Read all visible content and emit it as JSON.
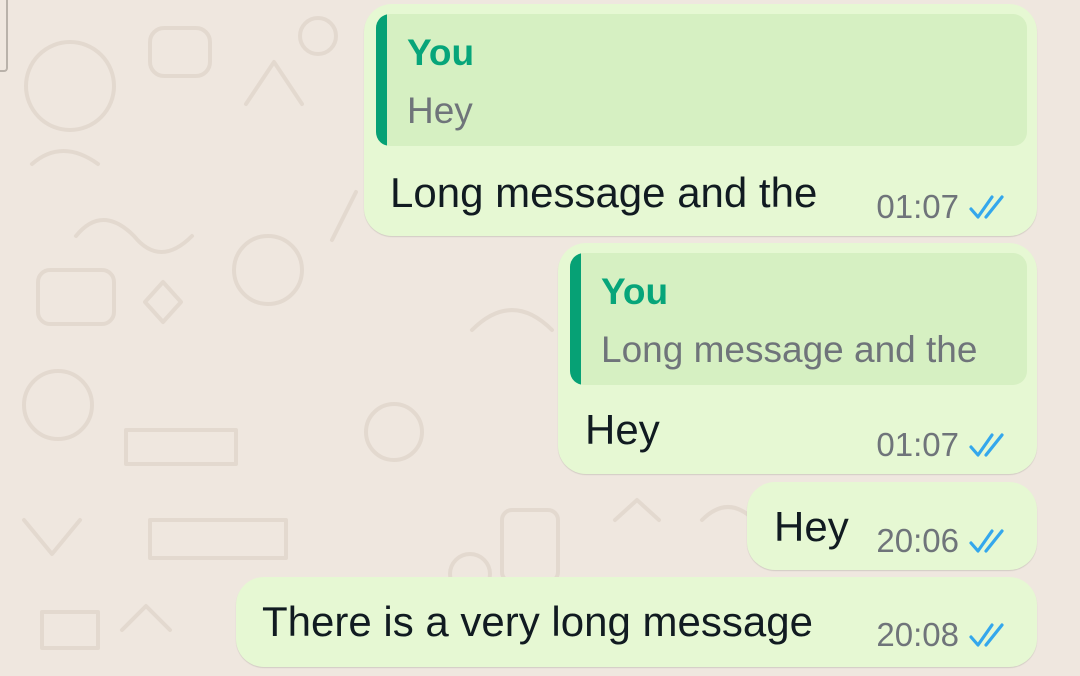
{
  "colors": {
    "background": "#efe7df",
    "outgoing_bubble": "#e6f8d3",
    "quote_box": "#d6f0c2",
    "quote_bar": "#06a175",
    "quote_author": "#07a57a",
    "message_text": "#111b21",
    "meta_text": "#6f747a",
    "read_ticks": "#34a7ec"
  },
  "messages": [
    {
      "reply_to": {
        "author": "You",
        "text": "Hey"
      },
      "text": "Long message and the",
      "time": "01:07",
      "status_icon": "double-check-read-icon"
    },
    {
      "reply_to": {
        "author": "You",
        "text": "Long message and the"
      },
      "text": "Hey",
      "time": "01:07",
      "status_icon": "double-check-read-icon"
    },
    {
      "text": "Hey",
      "time": "20:06",
      "status_icon": "double-check-read-icon"
    },
    {
      "text": "There is a very long message",
      "time": "20:08",
      "status_icon": "double-check-read-icon"
    }
  ]
}
